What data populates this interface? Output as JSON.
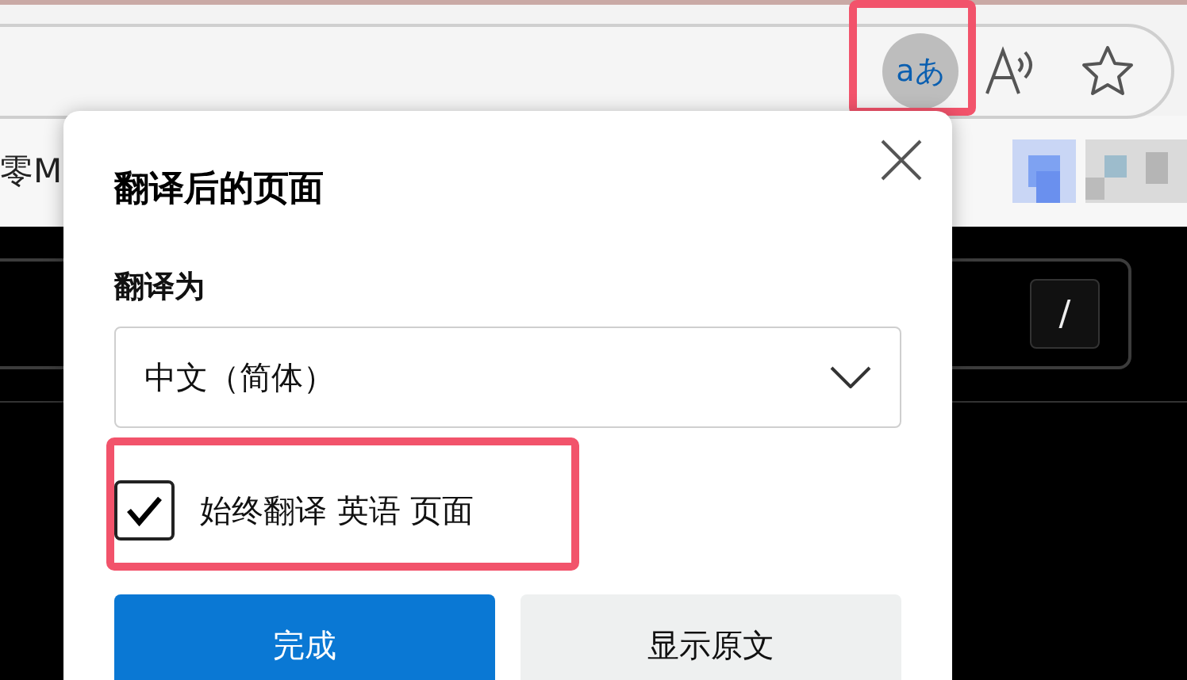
{
  "toolbar": {
    "translate_icon": "aあ"
  },
  "bookmarks_bar": {
    "items": [
      {
        "label": "零M"
      }
    ]
  },
  "page": {
    "shortcut_key": "/"
  },
  "translate_popup": {
    "title": "翻译后的页面",
    "target_label": "翻译为",
    "target_language": "中文（简体）",
    "always_translate": {
      "label": "始终翻译 英语 页面",
      "checked": true
    },
    "buttons": [
      {
        "label": "完成",
        "kind": "primary"
      },
      {
        "label": "显示原文",
        "kind": "secondary"
      }
    ]
  }
}
